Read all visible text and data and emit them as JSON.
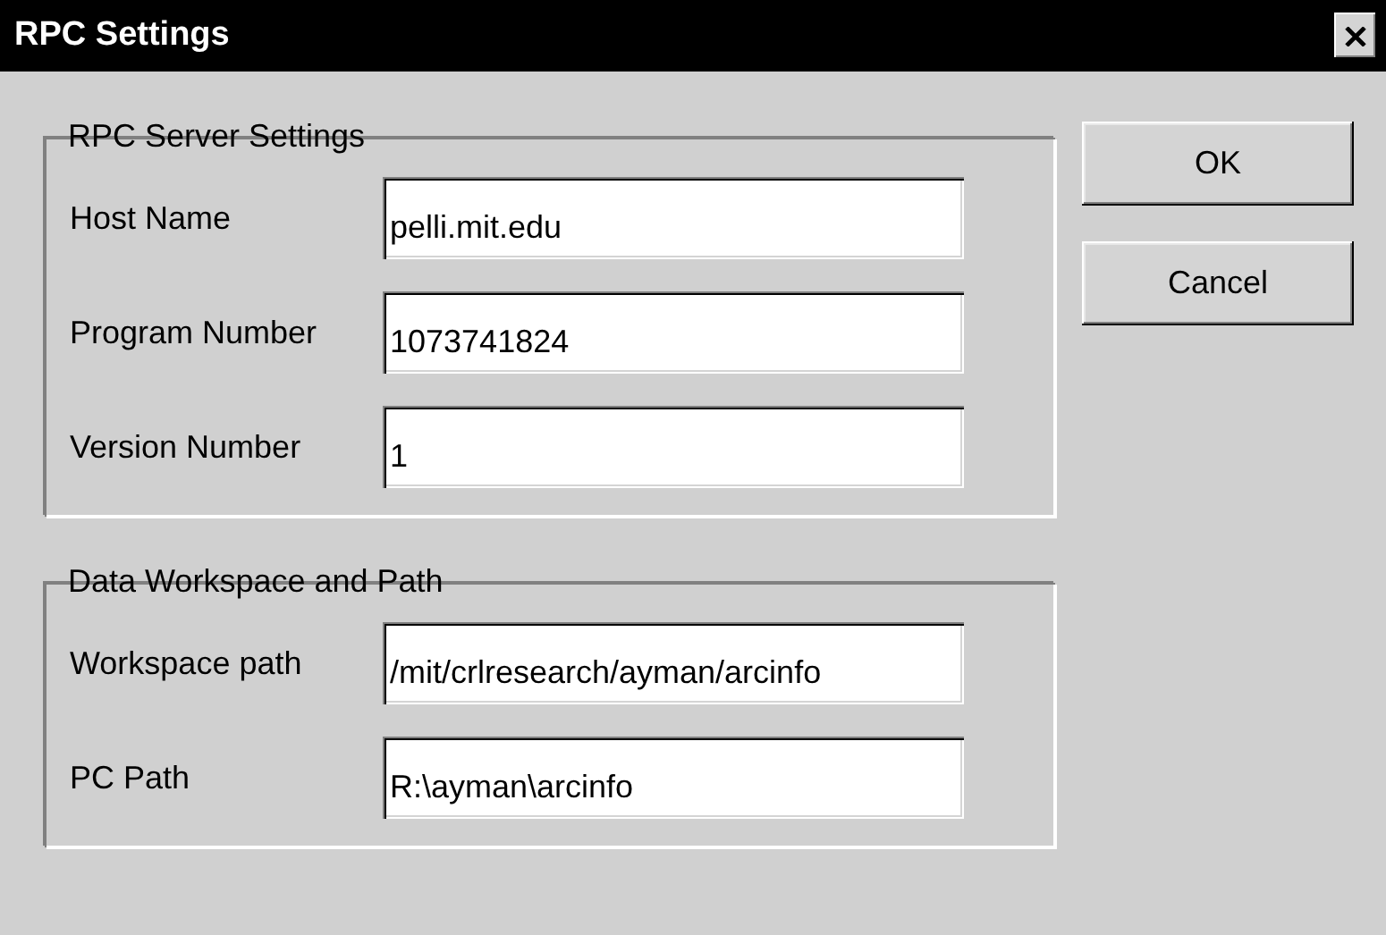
{
  "window": {
    "title": "RPC Settings"
  },
  "groups": [
    {
      "legend": "RPC Server Settings",
      "fields": [
        {
          "label": "Host Name",
          "value": "pelli.mit.edu"
        },
        {
          "label": "Program Number",
          "value": "1073741824"
        },
        {
          "label": "Version Number",
          "value": "1"
        }
      ]
    },
    {
      "legend": "Data Workspace and Path",
      "fields": [
        {
          "label": "Workspace path",
          "value": "/mit/crlresearch/ayman/arcinfo"
        },
        {
          "label": "PC Path",
          "value": "R:\\ayman\\arcinfo"
        }
      ]
    }
  ],
  "buttons": [
    "OK",
    "Cancel"
  ]
}
